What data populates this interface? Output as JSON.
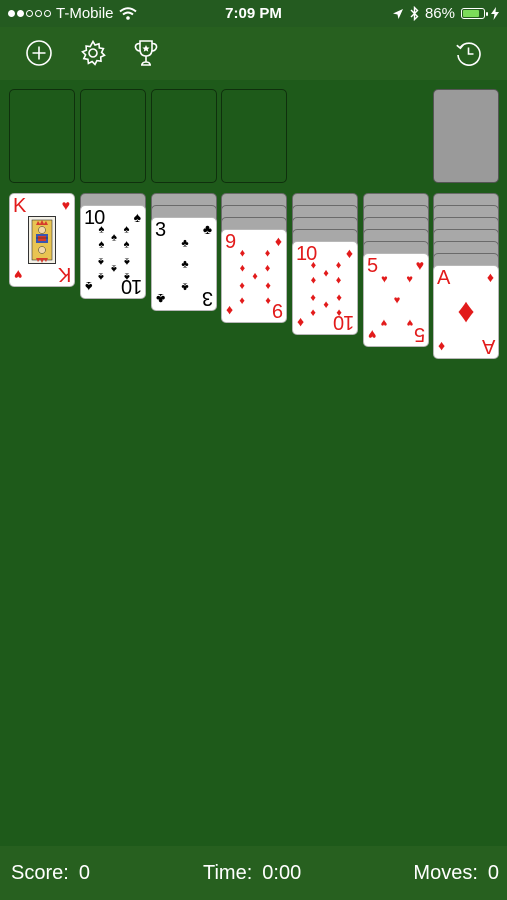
{
  "status_bar": {
    "carrier": "T-Mobile",
    "time": "7:09 PM",
    "battery_percent": "86%",
    "battery_level": 0.86,
    "signal_bars": 2,
    "signal_total": 5
  },
  "toolbar": {
    "left_icons": [
      "new-game-icon",
      "settings-icon",
      "achievements-icon"
    ],
    "right_icons": [
      "undo-icon"
    ]
  },
  "foundations": [
    {
      "empty": true
    },
    {
      "empty": true
    },
    {
      "empty": true
    },
    {
      "empty": true
    }
  ],
  "stock": {
    "face_down": true
  },
  "tableau": [
    {
      "hidden": 0,
      "rank": "K",
      "suit": "♥",
      "color": "red",
      "suit_name": "hearts"
    },
    {
      "hidden": 1,
      "rank": "10",
      "suit": "♠",
      "color": "black",
      "suit_name": "spades"
    },
    {
      "hidden": 2,
      "rank": "3",
      "suit": "♣",
      "color": "black",
      "suit_name": "clubs"
    },
    {
      "hidden": 3,
      "rank": "9",
      "suit": "♦",
      "color": "red",
      "suit_name": "diamonds"
    },
    {
      "hidden": 4,
      "rank": "10",
      "suit": "♦",
      "color": "red",
      "suit_name": "diamonds"
    },
    {
      "hidden": 5,
      "rank": "5",
      "suit": "♥",
      "color": "red",
      "suit_name": "hearts"
    },
    {
      "hidden": 6,
      "rank": "A",
      "suit": "♦",
      "color": "red",
      "suit_name": "diamonds"
    }
  ],
  "stats": {
    "score_label": "Score:",
    "score_value": "0",
    "time_label": "Time:",
    "time_value": "0:00",
    "moves_label": "Moves:",
    "moves_value": "0"
  },
  "colors": {
    "felt": "#1e5a1a",
    "bars": "#27601f",
    "red_suit": "#e21b1b",
    "black_suit": "#000000"
  }
}
